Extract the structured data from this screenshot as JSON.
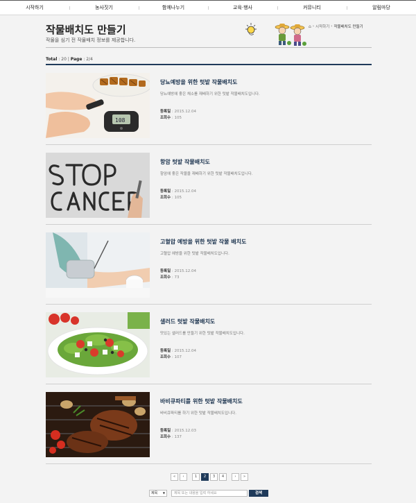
{
  "nav": {
    "items": [
      "시작하기",
      "농사짓기",
      "함께나누기",
      "교육·행사",
      "커뮤니티",
      "알림마당"
    ]
  },
  "page": {
    "title": "작물배치도 만들기",
    "subtitle": "작물을 심기 전 작물배치 정보를 제공합니다."
  },
  "breadcrumb": {
    "home_icon": "home-icon",
    "items": [
      "시작하기",
      "작물배치도 만들기"
    ]
  },
  "summary": {
    "total_label": "Total",
    "total_value": "20",
    "page_label": "Page",
    "page_value": "2/4"
  },
  "meta_labels": {
    "date": "등록일",
    "views": "조회수"
  },
  "items": [
    {
      "title": "당뇨예방을 위한 텃밭 작물배치도",
      "desc": "당뇨예방에 좋은 채소를 재배하기 위한 텃밭 작물배치도입니다.",
      "date": "2015.12.04",
      "views": "105",
      "image": "diabetes-test-photo"
    },
    {
      "title": "항암 텃밭 작물배치도",
      "desc": "항암에 좋은 작물을 재배하기 위한 텃밭 작물배치도입니다.",
      "date": "2015.12.04",
      "views": "105",
      "image": "stop-cancer-photo"
    },
    {
      "title": "고혈압 예방을 위한 텃밭 작물 배치도",
      "desc": "고혈압 예방을 위한 텃밭 작물배치도입니다.",
      "date": "2015.12.04",
      "views": "73",
      "image": "blood-pressure-photo"
    },
    {
      "title": "샐러드 텃밭 작물배치도",
      "desc": "맛있는 샐러드를 만들기 위한 텃밭 작물배치도입니다.",
      "date": "2015.12.04",
      "views": "107",
      "image": "salad-photo"
    },
    {
      "title": "바비큐파티를 위한 텃밭 작물배치도",
      "desc": "바비큐파티를 하기 위한 텃밭 작물배치도입니다.",
      "date": "2015.12.03",
      "views": "137",
      "image": "bbq-photo"
    }
  ],
  "pagination": {
    "first": "«",
    "prev": "‹",
    "pages": [
      "1",
      "2",
      "3",
      "4"
    ],
    "current": "2",
    "next": "›",
    "last": "»"
  },
  "search": {
    "select_value": "제목",
    "placeholder": "제목 또는 내용을 입력 하세요",
    "button_label": "검색"
  },
  "colors": {
    "accent": "#1f3a5a",
    "title": "#1e3550"
  }
}
